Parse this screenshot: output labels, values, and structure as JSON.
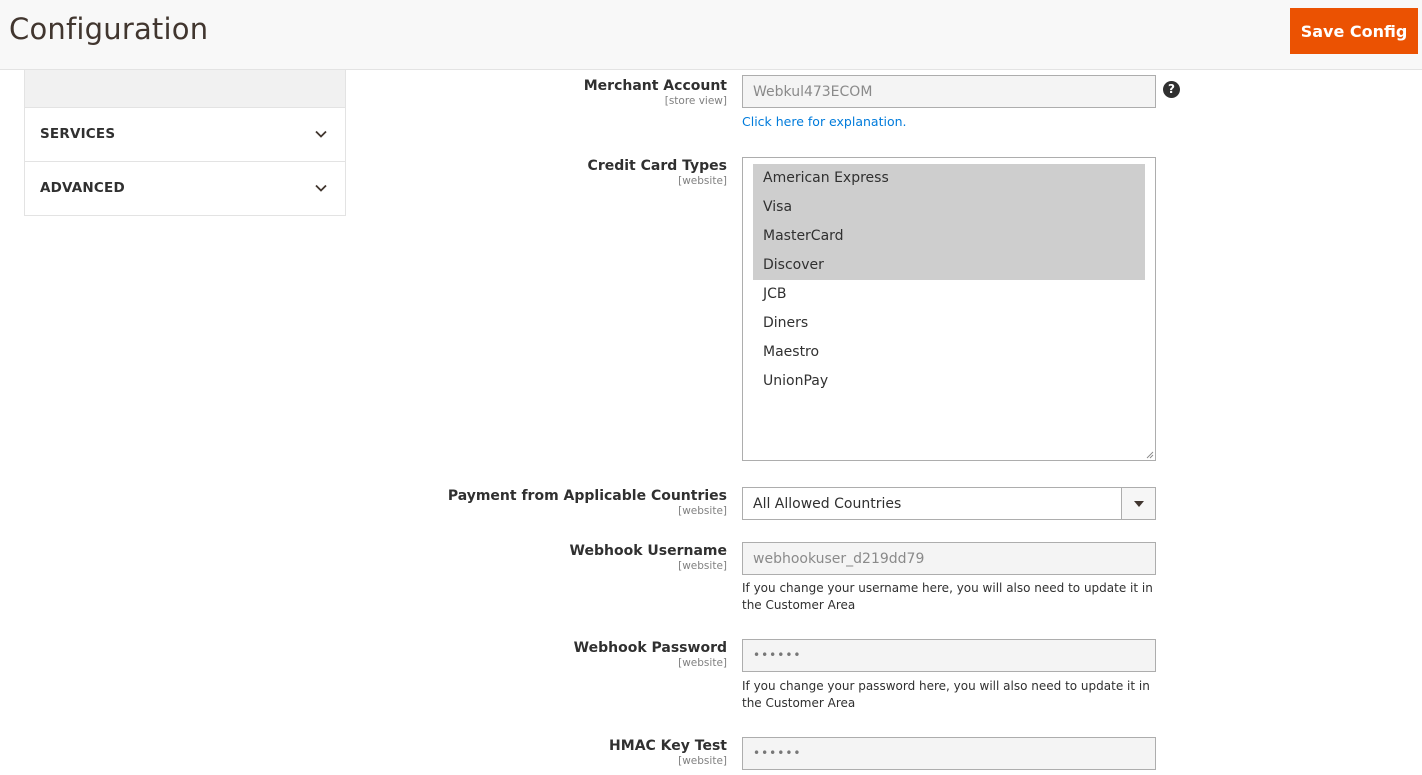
{
  "header": {
    "title": "Configuration",
    "save_label": "Save Config"
  },
  "sidebar": {
    "items": [
      {
        "label": "SERVICES"
      },
      {
        "label": "ADVANCED"
      }
    ]
  },
  "form": {
    "merchant_account": {
      "label": "Merchant Account",
      "scope": "[store view]",
      "value": "Webkul473ECOM",
      "help_icon": "?",
      "link": "Click here for explanation."
    },
    "credit_card_types": {
      "label": "Credit Card Types",
      "scope": "[website]",
      "options": [
        {
          "label": "American Express",
          "selected": true
        },
        {
          "label": "Visa",
          "selected": true
        },
        {
          "label": "MasterCard",
          "selected": true
        },
        {
          "label": "Discover",
          "selected": true
        },
        {
          "label": "JCB",
          "selected": false
        },
        {
          "label": "Diners",
          "selected": false
        },
        {
          "label": "Maestro",
          "selected": false
        },
        {
          "label": "UnionPay",
          "selected": false
        }
      ]
    },
    "applicable_countries": {
      "label": "Payment from Applicable Countries",
      "scope": "[website]",
      "value": "All Allowed Countries"
    },
    "webhook_username": {
      "label": "Webhook Username",
      "scope": "[website]",
      "value": "webhookuser_d219dd79",
      "note": "If you change your username here, you will also need to update it in the Customer Area"
    },
    "webhook_password": {
      "label": "Webhook Password",
      "scope": "[website]",
      "value": "••••••",
      "note": "If you change your password here, you will also need to update it in the Customer Area"
    },
    "hmac_key_test": {
      "label": "HMAC Key Test",
      "scope": "[website]",
      "value": "••••••"
    }
  }
}
